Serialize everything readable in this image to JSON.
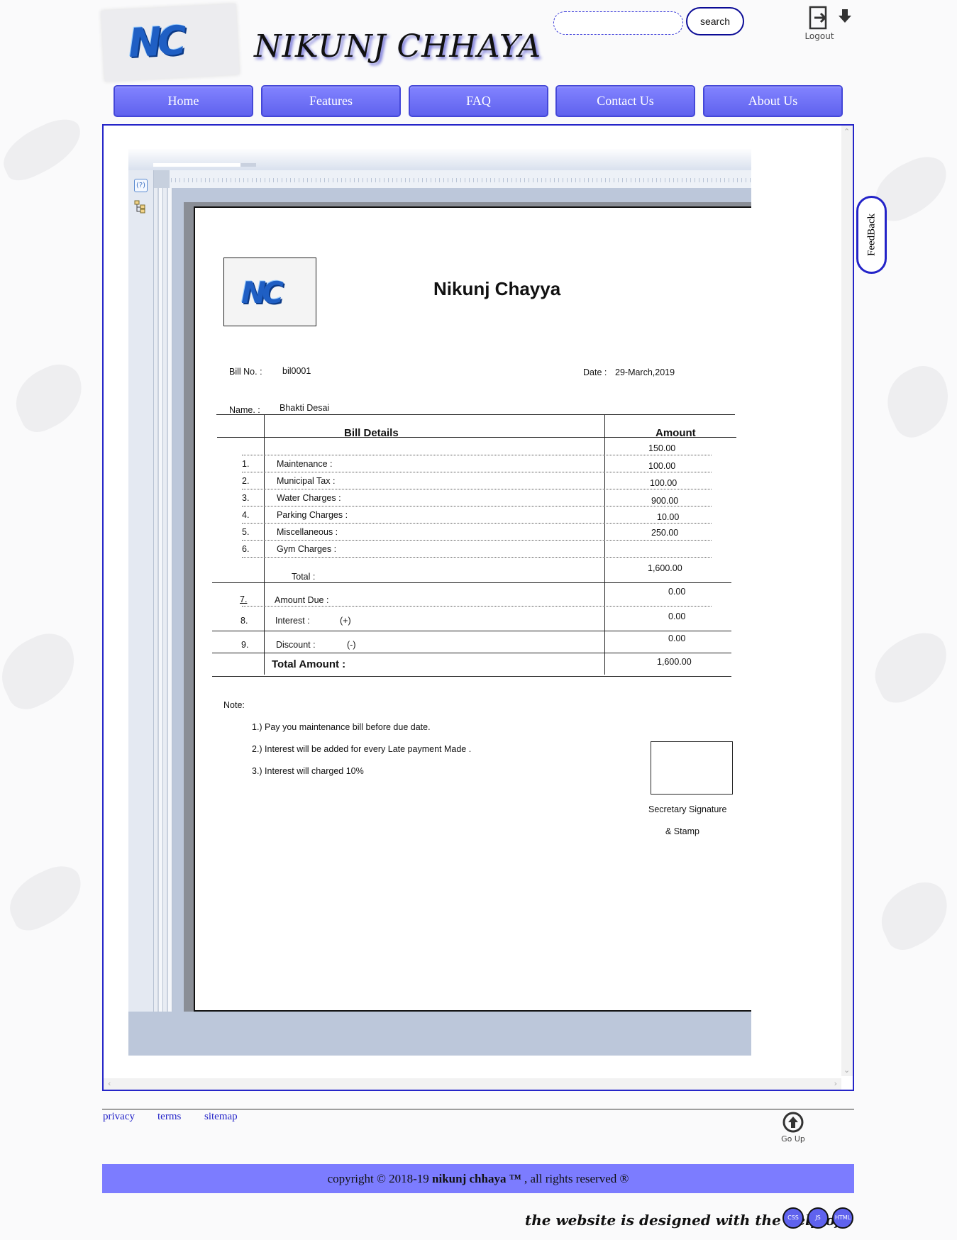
{
  "header": {
    "site_title": "NIKUNJ CHHAYA",
    "logo_text": "NC",
    "search": {
      "value": "",
      "button_label": "search"
    },
    "logout_label": "Logout"
  },
  "nav": [
    "Home",
    "Features",
    "FAQ",
    "Contact Us",
    "About Us"
  ],
  "feedback_label": "FeedBack",
  "bill": {
    "logo_text": "NC",
    "title": "Nikunj Chayya",
    "bill_no_label": "Bill No. :",
    "bill_no": "bil0001",
    "date_label": "Date :",
    "date": "29-March,2019",
    "name_label": "Name. :",
    "name": "Bhakti Desai",
    "col_details": "Bill Details",
    "col_amount": "Amount",
    "amounts": [
      "150.00",
      "100.00",
      "100.00",
      "900.00",
      "10.00",
      "250.00"
    ],
    "items": [
      {
        "no": "1.",
        "label": "Maintenance :"
      },
      {
        "no": "2.",
        "label": "Municipal Tax :"
      },
      {
        "no": "3.",
        "label": "Water Charges :"
      },
      {
        "no": "4.",
        "label": "Parking Charges :"
      },
      {
        "no": "5.",
        "label": "Miscellaneous :"
      },
      {
        "no": "6.",
        "label": "Gym Charges :"
      }
    ],
    "total_label": "Total :",
    "total_value": "1,600.00",
    "amount_due": {
      "no": "7.",
      "label": "Amount Due :",
      "value": "0.00"
    },
    "interest": {
      "no": "8.",
      "label": "Interest :",
      "sign": "(+)",
      "value": "0.00"
    },
    "discount": {
      "no": "9.",
      "label": "Discount :",
      "sign": "(-)",
      "value": "0.00"
    },
    "grand_total_label": "Total Amount :",
    "grand_total_value": "1,600.00",
    "note_label": "Note:",
    "notes": [
      "1.) Pay you maintenance bill before due date.",
      "2.) Interest will be added for every Late payment Made .",
      "3.) Interest will charged 10%"
    ],
    "signature_line1": "Secretary Signature",
    "signature_line2": "& Stamp"
  },
  "footer": {
    "links": [
      "privacy",
      "terms",
      "sitemap"
    ],
    "go_up_label": "Go Up",
    "copyright_prefix": "copyright © 2018-19 ",
    "copyright_brand": "nikunj chhaya ™",
    "copyright_suffix": " , all rights reserved ®",
    "credit": "the website is designed with the help of",
    "badges": [
      "CSS",
      "JS",
      "HTML"
    ]
  },
  "colors": {
    "accent": "#7c7cff",
    "nav": "#6b6eff",
    "frame_border": "#2525c8"
  },
  "icons": [
    "logout-icon",
    "download-icon",
    "help-icon",
    "tree-icon",
    "go-up-icon"
  ]
}
